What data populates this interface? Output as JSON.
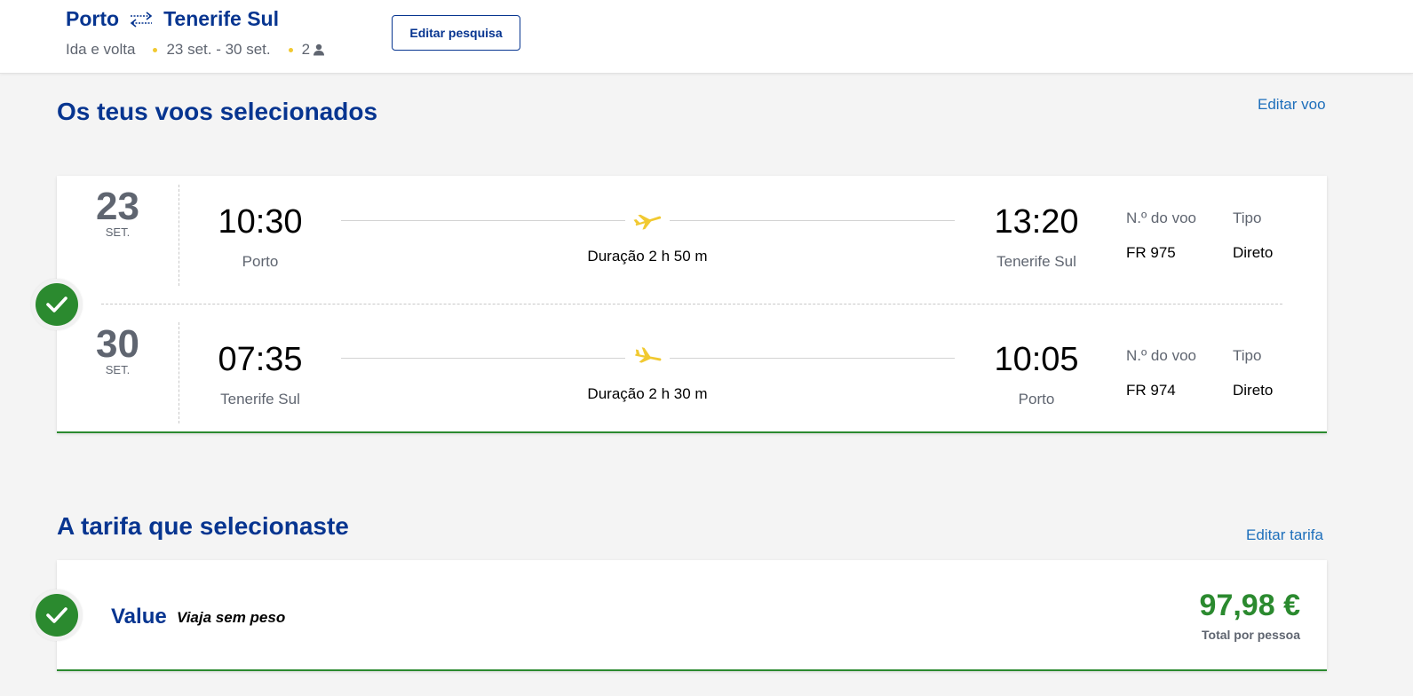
{
  "header": {
    "origin": "Porto",
    "destination": "Tenerife Sul",
    "trip_type": "Ida e volta",
    "dates": "23 set. - 30 set.",
    "passengers": "2",
    "edit_search_label": "Editar pesquisa"
  },
  "flights_section": {
    "title": "Os teus voos selecionados",
    "edit_label": "Editar voo",
    "legs": [
      {
        "day": "23",
        "month": "SET.",
        "departure_time": "10:30",
        "departure_city": "Porto",
        "duration": "Duração 2 h 50 m",
        "arrival_time": "13:20",
        "arrival_city": "Tenerife Sul",
        "flight_no_label": "N.º do voo",
        "flight_no": "FR 975",
        "type_label": "Tipo",
        "type": "Direto"
      },
      {
        "day": "30",
        "month": "SET.",
        "departure_time": "07:35",
        "departure_city": "Tenerife Sul",
        "duration": "Duração 2 h 30 m",
        "arrival_time": "10:05",
        "arrival_city": "Porto",
        "flight_no_label": "N.º do voo",
        "flight_no": "FR 974",
        "type_label": "Tipo",
        "type": "Direto"
      }
    ]
  },
  "fare_section": {
    "title": "A tarifa que selecionaste",
    "edit_label": "Editar tarifa",
    "fare_name": "Value",
    "fare_description": "Viaja sem peso",
    "price": "97,98 €",
    "price_note": "Total por pessoa"
  },
  "colors": {
    "brand_blue": "#073590",
    "link_blue": "#1e6fbb",
    "success_green": "#2b8a2f",
    "accent_yellow": "#f1c931"
  }
}
